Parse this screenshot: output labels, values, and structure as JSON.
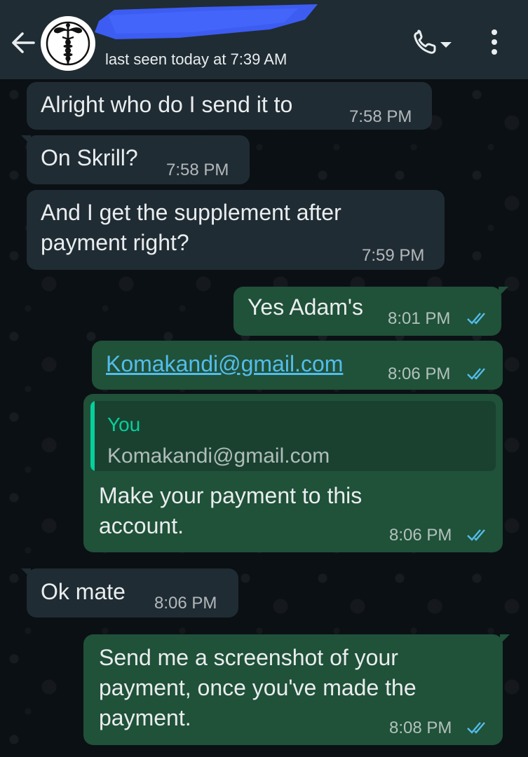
{
  "header": {
    "contact_name": "",
    "status": "last seen today at 7:39 AM",
    "back_icon": "arrow-left-icon",
    "avatar_icon": "caduceus-icon",
    "call_icon": "phone-icon",
    "menu_icon": "more-vertical-icon"
  },
  "messages": [
    {
      "direction": "incoming",
      "text": "Alright who do I send it to",
      "time": "7:58 PM"
    },
    {
      "direction": "incoming",
      "text": "On Skrill?",
      "time": "7:58 PM"
    },
    {
      "direction": "incoming",
      "text_lines": [
        "And I get the supplement after",
        "payment right?"
      ],
      "time": "7:59 PM"
    },
    {
      "direction": "outgoing",
      "text": "Yes Adam's",
      "time": "8:01 PM",
      "status": "read"
    },
    {
      "direction": "outgoing",
      "text": "Komakandi@gmail.com",
      "is_link": true,
      "time": "8:06 PM",
      "status": "read"
    },
    {
      "direction": "outgoing",
      "quote": {
        "author": "You",
        "text": "Komakandi@gmail.com"
      },
      "text_lines": [
        "Make your payment to this",
        "account."
      ],
      "time": "8:06 PM",
      "status": "read"
    },
    {
      "direction": "incoming",
      "text": "Ok mate",
      "time": "8:06 PM"
    },
    {
      "direction": "outgoing",
      "text_lines": [
        "Send me a screenshot of your",
        "payment, once you've made the",
        "payment."
      ],
      "time": "8:08 PM",
      "status": "read"
    }
  ],
  "colors": {
    "header_bg": "#1f2c33",
    "incoming_bubble": "#202c33",
    "outgoing_bubble": "#205139",
    "read_ticks": "#53bdeb",
    "link": "#53bdeb",
    "quote_accent": "#06cf9c"
  }
}
